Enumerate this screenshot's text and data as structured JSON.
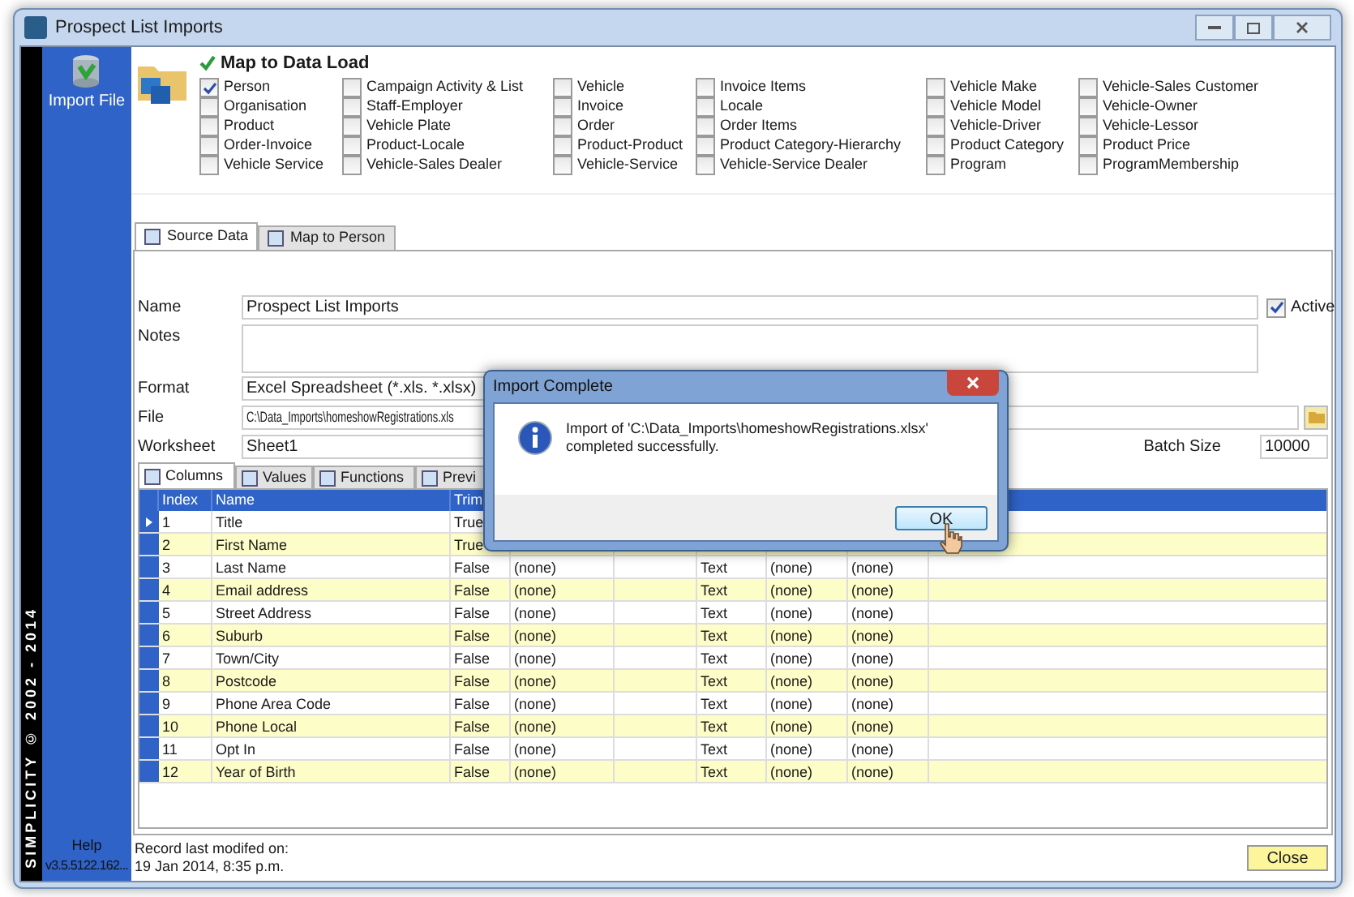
{
  "window": {
    "title": "Prospect List Imports"
  },
  "sidebar": {
    "items": [
      {
        "label": "Import File"
      }
    ],
    "brand": "SIMPLICITY © 2002 - 2014",
    "help": "Help",
    "version": "v3.5.5122.162..."
  },
  "data_load": {
    "title": "Map to Data Load",
    "columns": [
      [
        {
          "label": "Person",
          "checked": true
        },
        {
          "label": "Organisation",
          "checked": false
        },
        {
          "label": "Product",
          "checked": false
        },
        {
          "label": "Order-Invoice",
          "checked": false
        },
        {
          "label": "Vehicle Service",
          "checked": false
        }
      ],
      [
        {
          "label": "Campaign Activity & List",
          "checked": false
        },
        {
          "label": "Staff-Employer",
          "checked": false
        },
        {
          "label": "Vehicle Plate",
          "checked": false
        },
        {
          "label": "Product-Locale",
          "checked": false
        },
        {
          "label": "Vehicle-Sales Dealer",
          "checked": false
        }
      ],
      [
        {
          "label": "Vehicle",
          "checked": false
        },
        {
          "label": "Invoice",
          "checked": false
        },
        {
          "label": "Order",
          "checked": false
        },
        {
          "label": "Product-Product",
          "checked": false
        },
        {
          "label": "Vehicle-Service",
          "checked": false
        }
      ],
      [
        {
          "label": "Invoice Items",
          "checked": false
        },
        {
          "label": "Locale",
          "checked": false
        },
        {
          "label": "Order Items",
          "checked": false
        },
        {
          "label": "Product Category-Hierarchy",
          "checked": false
        },
        {
          "label": "Vehicle-Service Dealer",
          "checked": false
        }
      ],
      [
        {
          "label": "Vehicle Make",
          "checked": false
        },
        {
          "label": "Vehicle Model",
          "checked": false
        },
        {
          "label": "Vehicle-Driver",
          "checked": false
        },
        {
          "label": "Product Category",
          "checked": false
        },
        {
          "label": "Program",
          "checked": false
        }
      ],
      [
        {
          "label": "Vehicle-Sales Customer",
          "checked": false
        },
        {
          "label": "Vehicle-Owner",
          "checked": false
        },
        {
          "label": "Vehicle-Lessor",
          "checked": false
        },
        {
          "label": "Product Price",
          "checked": false
        },
        {
          "label": "ProgramMembership",
          "checked": false
        }
      ]
    ]
  },
  "tabs": [
    {
      "label": "Source Data",
      "selected": true
    },
    {
      "label": "Map to Person",
      "selected": false
    }
  ],
  "form": {
    "name_label": "Name",
    "name": "Prospect List Imports",
    "active": {
      "label": "Active",
      "checked": true
    },
    "notes_label": "Notes",
    "format_label": "Format",
    "format": "Excel Spreadsheet (*.xls. *.xlsx)",
    "file_label": "File",
    "file": "C:\\Data_Imports\\homeshowRegistrations.xls",
    "worksheet_label": "Worksheet",
    "worksheet": "Sheet1",
    "batch_label": "Batch Size",
    "batch": "10000"
  },
  "sub_tabs": [
    {
      "label": "Columns",
      "selected": true
    },
    {
      "label": "Values",
      "selected": false
    },
    {
      "label": "Functions",
      "selected": false
    },
    {
      "label": "Previ",
      "selected": false
    }
  ],
  "table": {
    "columns": [
      "Index",
      "Name",
      "Trim"
    ],
    "rows": [
      {
        "current": true,
        "cells": [
          "1",
          "Title",
          "True"
        ]
      },
      {
        "current": false,
        "cells": [
          "2",
          "First Name",
          "True"
        ]
      },
      {
        "current": false,
        "cells": [
          "3",
          "Last Name",
          "False",
          "(none)",
          "",
          "Text",
          "(none)",
          "(none)"
        ]
      },
      {
        "current": false,
        "cells": [
          "4",
          "Email address",
          "False",
          "(none)",
          "",
          "Text",
          "(none)",
          "(none)"
        ]
      },
      {
        "current": false,
        "cells": [
          "5",
          "Street Address",
          "False",
          "(none)",
          "",
          "Text",
          "(none)",
          "(none)"
        ]
      },
      {
        "current": false,
        "cells": [
          "6",
          "Suburb",
          "False",
          "(none)",
          "",
          "Text",
          "(none)",
          "(none)"
        ]
      },
      {
        "current": false,
        "cells": [
          "7",
          "Town/City",
          "False",
          "(none)",
          "",
          "Text",
          "(none)",
          "(none)"
        ]
      },
      {
        "current": false,
        "cells": [
          "8",
          "Postcode",
          "False",
          "(none)",
          "",
          "Text",
          "(none)",
          "(none)"
        ]
      },
      {
        "current": false,
        "cells": [
          "9",
          "Phone Area Code",
          "False",
          "(none)",
          "",
          "Text",
          "(none)",
          "(none)"
        ]
      },
      {
        "current": false,
        "cells": [
          "10",
          "Phone Local",
          "False",
          "(none)",
          "",
          "Text",
          "(none)",
          "(none)"
        ]
      },
      {
        "current": false,
        "cells": [
          "11",
          "Opt In",
          "False",
          "(none)",
          "",
          "Text",
          "(none)",
          "(none)"
        ]
      },
      {
        "current": false,
        "cells": [
          "12",
          "Year of Birth",
          "False",
          "(none)",
          "",
          "Text",
          "(none)",
          "(none)"
        ]
      }
    ]
  },
  "footer": {
    "record_label": "Record last modifed on:",
    "record_date": "19 Jan 2014, 8:35 p.m.",
    "close": "Close"
  },
  "dialog": {
    "title": "Import Complete",
    "message": "Import of 'C:\\Data_Imports\\homeshowRegistrations.xlsx' completed successfully.",
    "ok": "OK"
  }
}
